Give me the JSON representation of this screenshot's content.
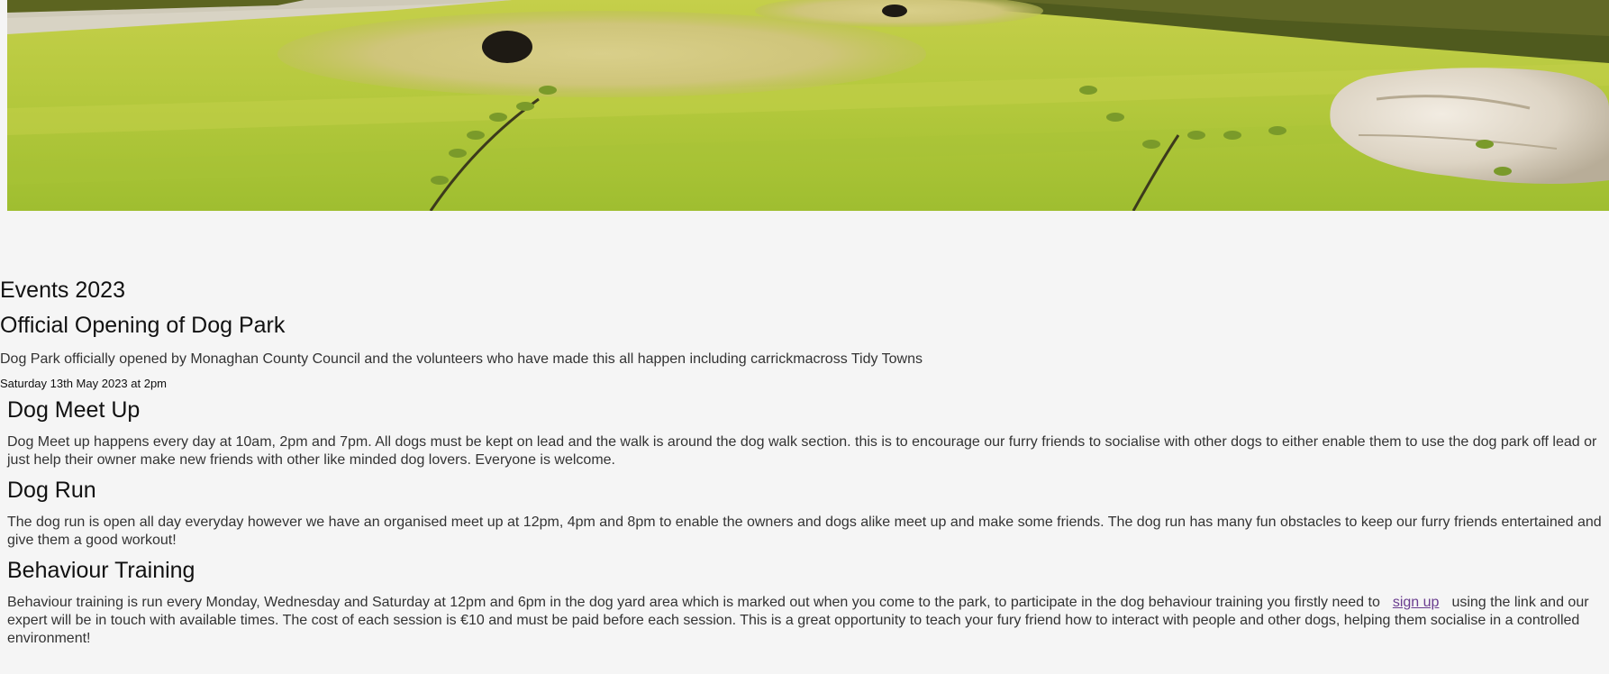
{
  "hero": {
    "image_name": "dog-park-lawn-image"
  },
  "events": {
    "title": "Events 2023",
    "opening": {
      "title": "Official Opening of Dog Park",
      "text": "Dog Park officially opened by Monaghan County Council and the volunteers who have made this all happen including carrickmacross Tidy Towns",
      "date": "Saturday 13th May 2023 at 2pm"
    },
    "meetup": {
      "title": "Dog Meet Up",
      "text": "Dog Meet up happens every day at 10am, 2pm and 7pm. All dogs must be kept on lead and the walk is around the dog walk section. this is to encourage our furry friends to socialise with other dogs to either enable them to use the dog park off lead or just help their owner make new friends with other like minded dog lovers. Everyone is welcome."
    },
    "run": {
      "title": "Dog Run",
      "text": "The dog run is open all day everyday however we have an organised meet up at 12pm, 4pm and 8pm to enable the owners and dogs alike meet up and make some friends. The dog run has many fun obstacles to keep our furry friends entertained and give them a good workout!"
    },
    "training": {
      "title": "Behaviour Training",
      "text_before": "Behaviour training is run every Monday, Wednesday and Saturday at 12pm and 6pm in the dog yard area which is marked out when you come to the park, to participate in the dog behaviour training you firstly need to",
      "link_label": "sign up",
      "text_after": "using the link and our expert will be in touch with available times. The cost of each session is €10 and must be paid before each session. This is a great opportunity to teach your fury friend how to interact with people and other dogs, helping them socialise in a controlled environment!"
    }
  },
  "colors": {
    "background": "#f5f5f5",
    "link": "#6a3d8f",
    "grass": "#a9c43a"
  }
}
